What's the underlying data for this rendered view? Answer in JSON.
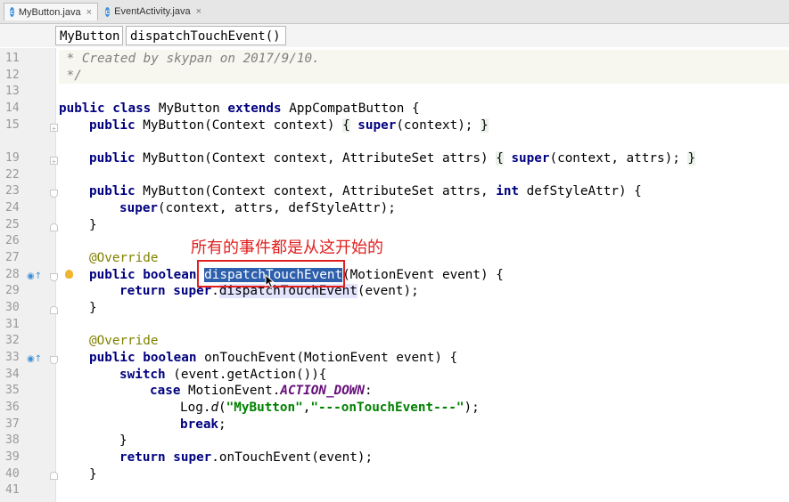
{
  "tabs": [
    {
      "label": "MyButton.java",
      "icon": "class-icon",
      "active": true
    },
    {
      "label": "EventActivity.java",
      "icon": "class-icon",
      "active": false
    }
  ],
  "tab_close_glyph": "×",
  "breadcrumb": [
    "MyButton",
    "dispatchTouchEvent()"
  ],
  "line_numbers": [
    "11",
    "12",
    "13",
    "14",
    "15",
    "19",
    "22",
    "23",
    "24",
    "25",
    "26",
    "27",
    "28",
    "29",
    "30",
    "31",
    "32",
    "33",
    "34",
    "35",
    "36",
    "37",
    "38",
    "39",
    "40",
    "41"
  ],
  "code": {
    "l11": " * Created by skypan on 2017/9/10.",
    "l12": " */",
    "l14_kw": "public class",
    "l14_rest": " MyButton ",
    "l14_kw2": "extends",
    "l14_end": " AppCompatButton {",
    "l15_kw": "public",
    "l15_mid": " MyButton(Context context) ",
    "l15_b1": "{",
    "l15_sp": " ",
    "l15_kw2": "super",
    "l15_end": "(context); ",
    "l15_b2": "}",
    "l19_kw": "public",
    "l19_mid": " MyButton(Context context, AttributeSet attrs) ",
    "l19_b1": "{",
    "l19_sp": " ",
    "l19_kw2": "super",
    "l19_end": "(context, attrs); ",
    "l19_b2": "}",
    "l23_kw": "public",
    "l23_mid": " MyButton(Context context, AttributeSet attrs, ",
    "l23_kw2": "int",
    "l23_end": " defStyleAttr) {",
    "l24_kw": "super",
    "l24_end": "(context, attrs, defStyleAttr);",
    "l25": "}",
    "l27": "@Override",
    "l28_kw": "public boolean",
    "l28_sel": "dispatchTouchEvent",
    "l28_end": "(MotionEvent event) {",
    "l29_kw": "return super",
    "l29_dot": ".",
    "l29_use": "dispatchTouchEvent",
    "l29_end": "(event);",
    "l30": "}",
    "l32": "@Override",
    "l33_kw": "public boolean",
    "l33_end": " onTouchEvent(MotionEvent event) {",
    "l34_kw": "switch",
    "l34_end": " (event.getAction()){",
    "l35_kw": "case",
    "l35_mid": " MotionEvent.",
    "l35_cst": "ACTION_DOWN",
    "l35_end": ":",
    "l36_a": "Log.",
    "l36_d": "d",
    "l36_p": "(",
    "l36_s1": "\"MyButton\"",
    "l36_c": ",",
    "l36_s2": "\"---onTouchEvent---\"",
    "l36_end": ");",
    "l37_kw": "break",
    "l37_end": ";",
    "l38": "}",
    "l39_kw": "return super",
    "l39_end": ".onTouchEvent(event);",
    "l40": "}"
  },
  "annotation": {
    "text": "所有的事件都是从这开始的",
    "color": "#e02020"
  },
  "colors": {
    "keyword": "#000080",
    "annotation": "#808000",
    "string": "#008000",
    "comment": "#808080",
    "constant": "#660e7a",
    "selection": "#2d5fad"
  }
}
